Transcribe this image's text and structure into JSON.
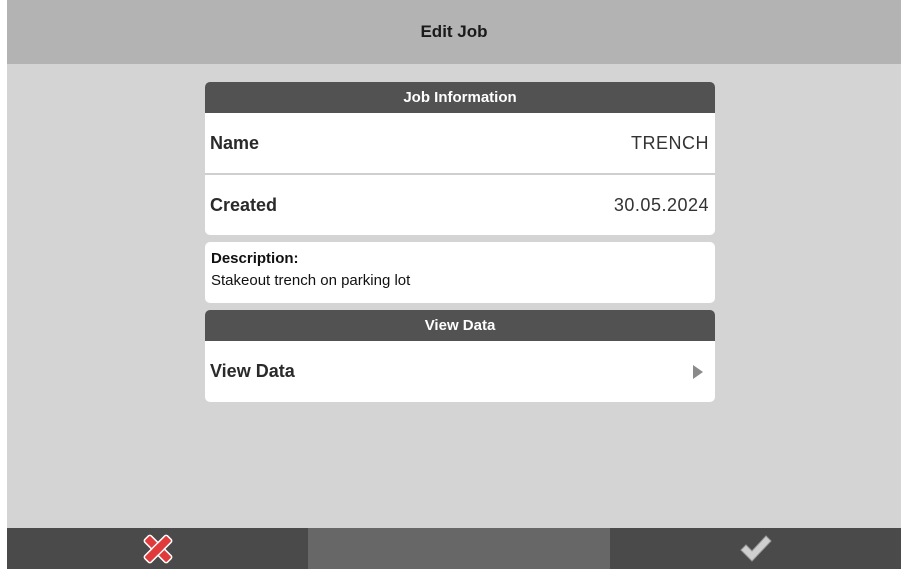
{
  "window": {
    "title": "Edit Job"
  },
  "job_info": {
    "header": "Job Information",
    "name_label": "Name",
    "name_value": "TRENCH",
    "created_label": "Created",
    "created_value": "30.05.2024"
  },
  "description": {
    "label": "Description:",
    "text": "Stakeout trench on parking lot"
  },
  "view_data": {
    "header": "View Data",
    "row_label": "View Data",
    "arrow_icon": "chevron-right-icon"
  },
  "toolbar": {
    "cancel_icon": "cancel-x-icon",
    "confirm_icon": "checkmark-icon",
    "cancel_color": "#e03a3a",
    "confirm_color": "#cfcfcf"
  }
}
